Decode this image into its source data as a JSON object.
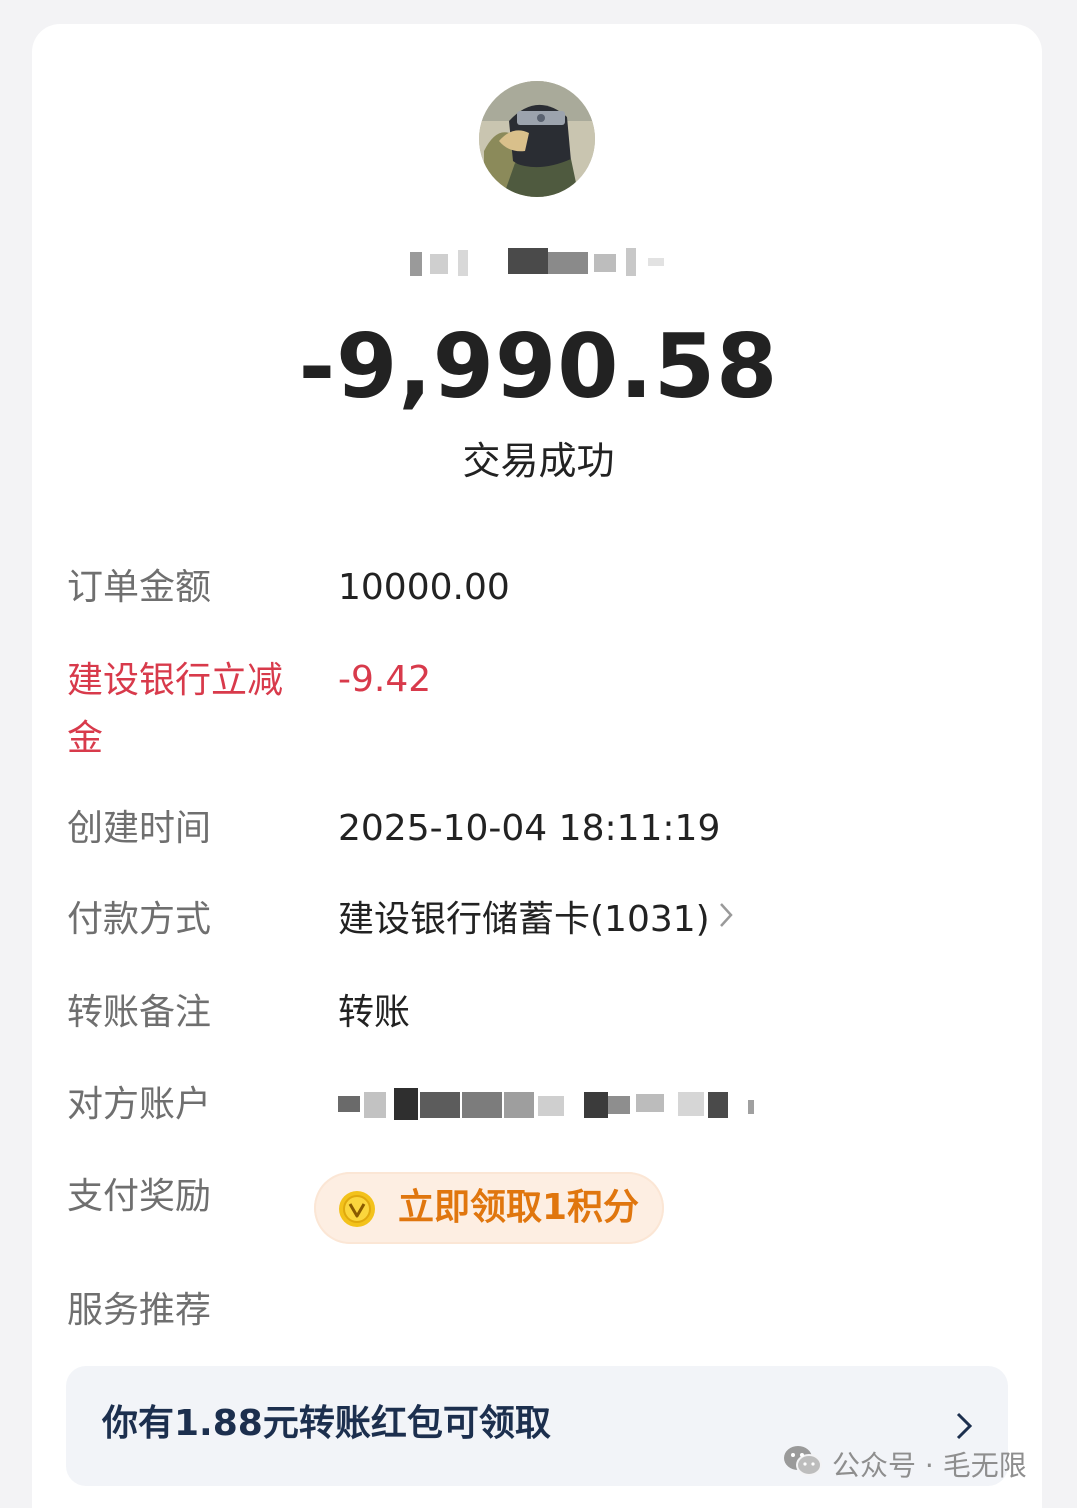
{
  "transaction": {
    "amount": "-9,990.58",
    "status": "交易成功"
  },
  "details": {
    "order_amount": {
      "label": "订单金额",
      "value": "10000.00"
    },
    "discount": {
      "label": "建设银行立减金",
      "value": "-9.42"
    },
    "created_time": {
      "label": "创建时间",
      "value": "2025-10-04 18:11:19"
    },
    "payment_method": {
      "label": "付款方式",
      "value": "建设银行储蓄卡(1031)"
    },
    "transfer_note": {
      "label": "转账备注",
      "value": "转账"
    },
    "counterparty": {
      "label": "对方账户"
    },
    "payment_reward": {
      "label": "支付奖励",
      "value": "立即领取1积分"
    },
    "service_recommend": {
      "label": "服务推荐"
    }
  },
  "promo": {
    "text": "你有1.88元转账红包可领取"
  },
  "watermark": {
    "text": "公众号 · 毛无限"
  },
  "colors": {
    "discount_red": "#d83a4b",
    "reward_orange": "#e0760e",
    "promo_navy": "#1c2f4e"
  },
  "icons": {
    "payment_method": "chevron-right-icon",
    "reward": "coin-icon",
    "promo": "chevron-right-icon",
    "watermark": "wechat-icon"
  }
}
